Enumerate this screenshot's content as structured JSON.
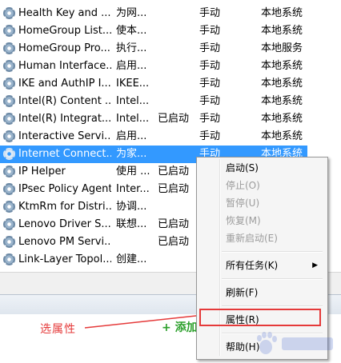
{
  "services": [
    {
      "name": "Health Key and ...",
      "desc": "为网...",
      "status": "",
      "startup": "手动",
      "logon": "本地系统"
    },
    {
      "name": "HomeGroup List...",
      "desc": "使本...",
      "status": "",
      "startup": "手动",
      "logon": "本地系统"
    },
    {
      "name": "HomeGroup Pro...",
      "desc": "执行...",
      "status": "",
      "startup": "手动",
      "logon": "本地服务"
    },
    {
      "name": "Human Interface...",
      "desc": "启用...",
      "status": "",
      "startup": "手动",
      "logon": "本地系统"
    },
    {
      "name": "IKE and AuthIP I...",
      "desc": "IKEE...",
      "status": "",
      "startup": "手动",
      "logon": "本地系统"
    },
    {
      "name": "Intel(R) Content ...",
      "desc": "Intel...",
      "status": "",
      "startup": "手动",
      "logon": "本地系统"
    },
    {
      "name": "Intel(R) Integrat...",
      "desc": "Intel...",
      "status": "已启动",
      "startup": "手动",
      "logon": "本地系统"
    },
    {
      "name": "Interactive Servi...",
      "desc": "启用...",
      "status": "",
      "startup": "手动",
      "logon": "本地系统"
    },
    {
      "name": "Internet Connect...",
      "desc": "为家...",
      "status": "",
      "startup": "手动",
      "logon": "本地系统",
      "selected": true
    },
    {
      "name": "IP Helper",
      "desc": "使用 ...",
      "status": "已启动",
      "startup": "",
      "logon": ""
    },
    {
      "name": "IPsec Policy Agent",
      "desc": "Inter...",
      "status": "已启动",
      "startup": "",
      "logon": ""
    },
    {
      "name": "KtmRm for Distri...",
      "desc": "协调...",
      "status": "",
      "startup": "",
      "logon": ""
    },
    {
      "name": "Lenovo Driver S...",
      "desc": "联想...",
      "status": "已启动",
      "startup": "",
      "logon": ""
    },
    {
      "name": "Lenovo PM Servi...",
      "desc": "",
      "status": "已启动",
      "startup": "",
      "logon": ""
    },
    {
      "name": "Link-Layer Topol...",
      "desc": "创建...",
      "status": "",
      "startup": "",
      "logon": ""
    }
  ],
  "context_menu": {
    "items": [
      {
        "label": "启动(S)",
        "enabled": true
      },
      {
        "label": "停止(O)",
        "enabled": false
      },
      {
        "label": "暂停(U)",
        "enabled": false
      },
      {
        "label": "恢复(M)",
        "enabled": false
      },
      {
        "label": "重新启动(E)",
        "enabled": false
      },
      {
        "separator": true
      },
      {
        "label": "所有任务(K)",
        "enabled": true,
        "submenu": true
      },
      {
        "separator": true
      },
      {
        "label": "刷新(F)",
        "enabled": true
      },
      {
        "separator": true
      },
      {
        "label": "属性(R)",
        "enabled": true,
        "highlighted": true
      },
      {
        "separator": true
      },
      {
        "label": "帮助(H)",
        "enabled": true
      }
    ],
    "submenu_arrow": "▶"
  },
  "annotation": {
    "label": "选属性",
    "color": "#e53a3a"
  },
  "bottom": {
    "add_link": "+ 添加"
  },
  "colors": {
    "selection": "#3399ff",
    "highlight_border": "#e53a3a",
    "add_link": "#2ca02c"
  },
  "watermark_icon": "baidu-paw-icon"
}
